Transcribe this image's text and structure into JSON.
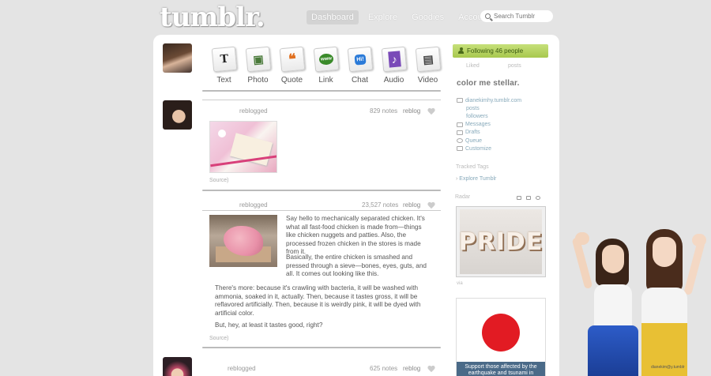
{
  "header": {
    "logo": "tumblr.",
    "nav": [
      {
        "label": "Dashboard",
        "active": true
      },
      {
        "label": "Explore",
        "active": false
      },
      {
        "label": "Goodies",
        "active": false
      },
      {
        "label": "Account",
        "active": false
      }
    ],
    "search_placeholder": "Search Tumblr"
  },
  "post_types": [
    {
      "label": "Text",
      "icon": "text-icon",
      "glyph": "T",
      "color": "#222222"
    },
    {
      "label": "Photo",
      "icon": "photo-icon",
      "glyph": "▣",
      "color": "#4a7a3a"
    },
    {
      "label": "Quote",
      "icon": "quote-icon",
      "glyph": "❝",
      "color": "#e07020"
    },
    {
      "label": "Link",
      "icon": "link-icon",
      "glyph": "www",
      "color": "#3a8a2a"
    },
    {
      "label": "Chat",
      "icon": "chat-icon",
      "glyph": "Hi!",
      "color": "#2a7ad8"
    },
    {
      "label": "Audio",
      "icon": "audio-icon",
      "glyph": "♪",
      "color": "#7a4ab8"
    },
    {
      "label": "Video",
      "icon": "video-icon",
      "glyph": "▤",
      "color": "#444444"
    }
  ],
  "posts": [
    {
      "meta": "reblogged",
      "notes": "829 notes",
      "reblog": "reblog",
      "source": "Source)"
    },
    {
      "meta": "reblogged",
      "notes": "23,527 notes",
      "reblog": "reblog",
      "paragraphs": [
        "Say hello to mechanically separated chicken. It's what all fast-food chicken is made from—things like chicken nuggets and patties. Also, the processed frozen chicken in the stores is made from it.",
        "Basically, the entire chicken is smashed and pressed through a sieve—bones, eyes, guts, and all. It comes out looking like this.",
        "There's more: because it's crawling with bacteria, it will be washed with ammonia, soaked in it, actually. Then, because it tastes gross, it will be reflavored artificially. Then, because it is weirdly pink, it will be dyed with artificial color.",
        "But, hey, at least it tastes good, right?"
      ],
      "source": "Source)"
    },
    {
      "meta": "reblogged",
      "notes": "625 notes",
      "reblog": "reblog"
    }
  ],
  "sidebar": {
    "following": "Following 46 people",
    "small_tabs": [
      "Liked",
      "posts"
    ],
    "blog_title": "color me stellar.",
    "blog_links": [
      {
        "label": "dianekimhy.tumblr.com",
        "icon": "home-icon",
        "indent": false
      },
      {
        "label": "posts",
        "icon": "",
        "indent": true
      },
      {
        "label": "followers",
        "icon": "",
        "indent": true
      },
      {
        "label": "Messages",
        "icon": "mail-icon",
        "indent": false
      },
      {
        "label": "Drafts",
        "icon": "draft-icon",
        "indent": false
      },
      {
        "label": "Queue",
        "icon": "clock-icon",
        "indent": false
      },
      {
        "label": "Customize",
        "icon": "paint-icon",
        "indent": false
      }
    ],
    "tracked_tags_heading": "Tracked Tags",
    "explore_link": "Explore Tumblr",
    "radar_heading": "Radar",
    "radar_word": "PRIDE",
    "via": "via",
    "ad_caption": "Support those affected by the earthquake and tsunami in"
  },
  "background_credit": "dianekim@y.tumblr",
  "colors": {
    "page_bg": "#e4e4e4",
    "follow_bar": "#b6d462",
    "japan_red": "#e21b23",
    "ad_caption_bg": "#4a6a88"
  }
}
